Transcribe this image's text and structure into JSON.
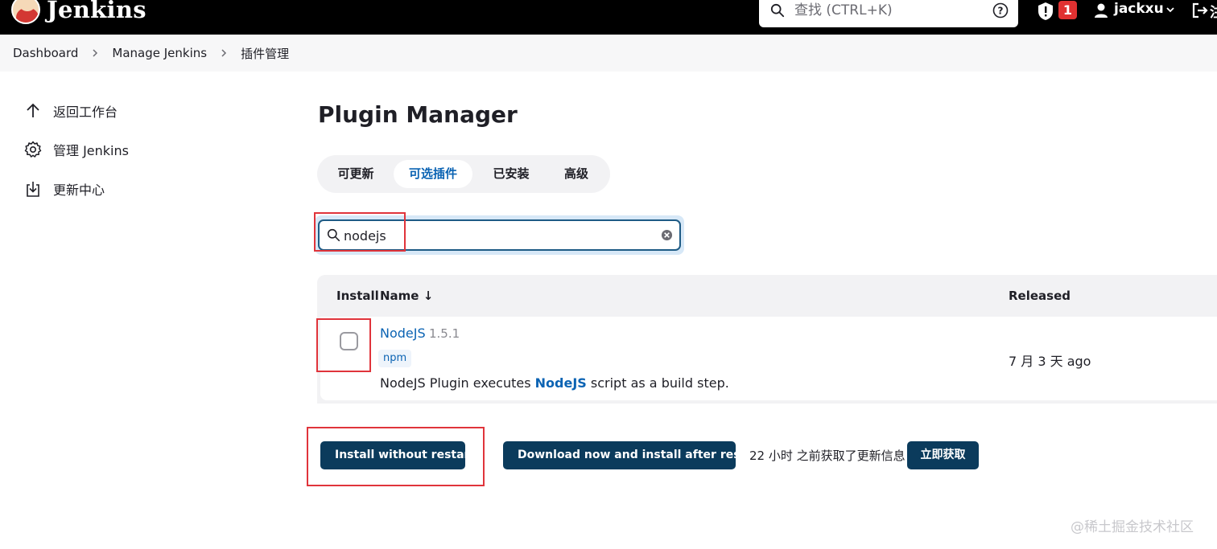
{
  "header": {
    "app_name": "Jenkins",
    "search_placeholder": "查找 (CTRL+K)",
    "notification_count": "1",
    "user_name": "jackxu",
    "logout_label": "注"
  },
  "breadcrumb": [
    "Dashboard",
    "Manage Jenkins",
    "插件管理"
  ],
  "sidebar": {
    "items": [
      {
        "label": "返回工作台",
        "icon": "arrow-up-icon"
      },
      {
        "label": "管理 Jenkins",
        "icon": "gear-icon"
      },
      {
        "label": "更新中心",
        "icon": "download-icon"
      }
    ]
  },
  "main": {
    "title": "Plugin Manager",
    "tabs": [
      {
        "label": "可更新",
        "active": false
      },
      {
        "label": "可选插件",
        "active": true
      },
      {
        "label": "已安装",
        "active": false
      },
      {
        "label": "高级",
        "active": false
      }
    ],
    "filter_value": "nodejs",
    "table": {
      "columns": {
        "install": "Install",
        "name": "Name ↓",
        "released": "Released"
      },
      "rows": [
        {
          "name": "NodeJS",
          "version": "1.5.1",
          "tag": "npm",
          "description_prefix": "NodeJS Plugin executes ",
          "description_bold": "NodeJS",
          "description_suffix": " script as a build step.",
          "released": "7 月 3 天 ago",
          "checked": false
        }
      ]
    },
    "actions": {
      "install_without_restart": "Install without restart",
      "download_install_after_restart": "Download now and install after restart",
      "update_info": "22 小时 之前获取了更新信息",
      "fetch_now": "立即获取"
    }
  },
  "watermark": "@稀土掘金技术社区",
  "colors": {
    "accent": "#0b63b3",
    "button": "#0b3b5c",
    "annotation": "#e0343b",
    "badge": "#e03131"
  }
}
